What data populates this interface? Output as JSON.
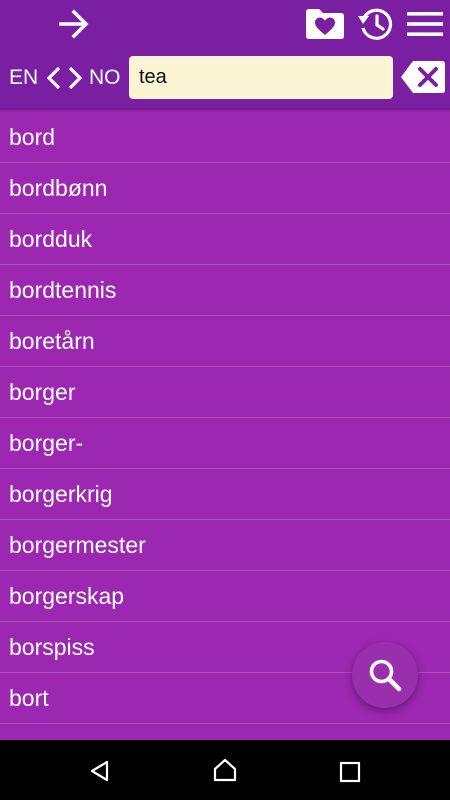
{
  "colors": {
    "header": "#7b1fa2",
    "list_background": "#9c27b0",
    "search_field": "#fbf5d6",
    "icon": "#ffffff",
    "nav_bar": "#000000"
  },
  "toolbar": {
    "forward_icon": "arrow-right-icon",
    "favorites_icon": "heart-folder-icon",
    "history_icon": "history-icon",
    "menu_icon": "hamburger-menu-icon"
  },
  "language": {
    "source": "EN",
    "target": "NO",
    "prev_icon": "chevron-left-icon",
    "next_icon": "chevron-right-icon"
  },
  "search": {
    "value": "tea",
    "clear_icon": "backspace-clear-icon"
  },
  "words": [
    "bord",
    "bordbønn",
    "bordduk",
    "bordtennis",
    "boretårn",
    "borger",
    "borger-",
    "borgerkrig",
    "borgermester",
    "borgerskap",
    "borspiss",
    "bort",
    ""
  ],
  "fab": {
    "icon": "search-icon"
  },
  "navigation": {
    "back_icon": "back-triangle-icon",
    "home_icon": "home-icon",
    "recents_icon": "recents-square-icon"
  }
}
